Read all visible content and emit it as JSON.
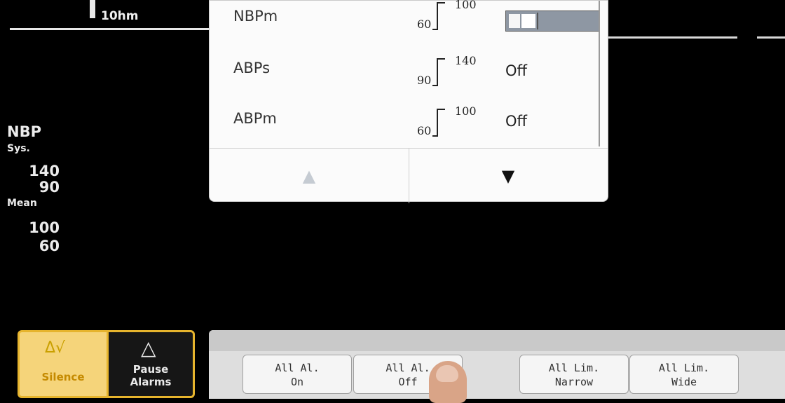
{
  "header": {
    "scale_label": "10hm"
  },
  "left_panel": {
    "title": "NBP",
    "sys_label": "Sys.",
    "sys_high": "140",
    "sys_low": "90",
    "mean_label": "Mean",
    "mean_high": "100",
    "mean_low": "60"
  },
  "popup": {
    "rows": [
      {
        "name": "NBPm",
        "low": "60",
        "high": "100",
        "status": ""
      },
      {
        "name": "ABPs",
        "low": "90",
        "high": "140",
        "status": "Off"
      },
      {
        "name": "ABPm",
        "low": "60",
        "high": "100",
        "status": "Off"
      }
    ],
    "nav": {
      "up_icon": "double-chevron-up-icon",
      "down_icon": "double-chevron-down-icon"
    }
  },
  "alarm_buttons": {
    "silence_label": "Silence",
    "pause_label_line1": "Pause",
    "pause_label_line2": "Alarms"
  },
  "softkeys": [
    {
      "line1": "All Al.",
      "line2": "On"
    },
    {
      "line1": "All Al.",
      "line2": "Off"
    },
    {
      "line1": "All Lim.",
      "line2": "Narrow"
    },
    {
      "line1": "All Lim.",
      "line2": "Wide"
    }
  ],
  "colors": {
    "alarm_yellow": "#f5d47a",
    "alarm_border": "#e6b42d",
    "background": "#000000"
  }
}
